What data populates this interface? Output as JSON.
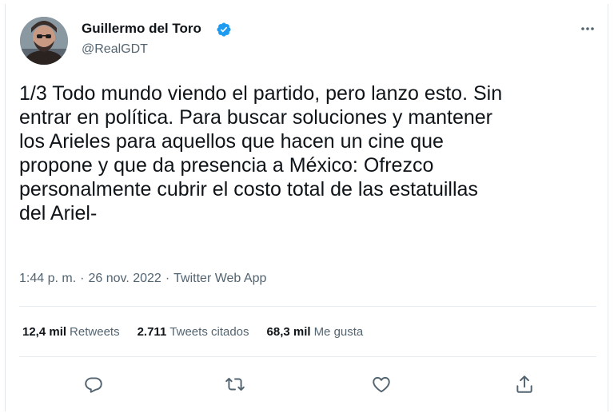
{
  "tweet": {
    "author": {
      "name": "Guillermo del Toro",
      "handle": "@RealGDT",
      "verified": true,
      "avatar_icon": "profile-photo"
    },
    "more_icon": "more-horizontal-icon",
    "text": "1/3 Todo mundo viendo el partido, pero lanzo esto. Sin\nentrar en política.  Para buscar soluciones y mantener\nlos Arieles para aquellos que hacen un cine que\npropone y que da presencia a México: Ofrezco\npersonalmente cubrir el costo total de las estatuillas\ndel Ariel-",
    "time": "1:44 p. m.",
    "date": "26 nov. 2022",
    "source": "Twitter Web App",
    "separator": "·",
    "stats": {
      "retweets": {
        "value": "12,4 mil",
        "label": "Retweets"
      },
      "quotes": {
        "value": "2.711",
        "label": "Tweets citados"
      },
      "likes": {
        "value": "68,3 mil",
        "label": "Me gusta"
      }
    },
    "actions": [
      "reply-icon",
      "retweet-icon",
      "like-icon",
      "share-icon"
    ]
  },
  "colors": {
    "text": "#0f1419",
    "secondary": "#536471",
    "verified": "#1d9bf0",
    "divider": "#e6ecf0"
  }
}
